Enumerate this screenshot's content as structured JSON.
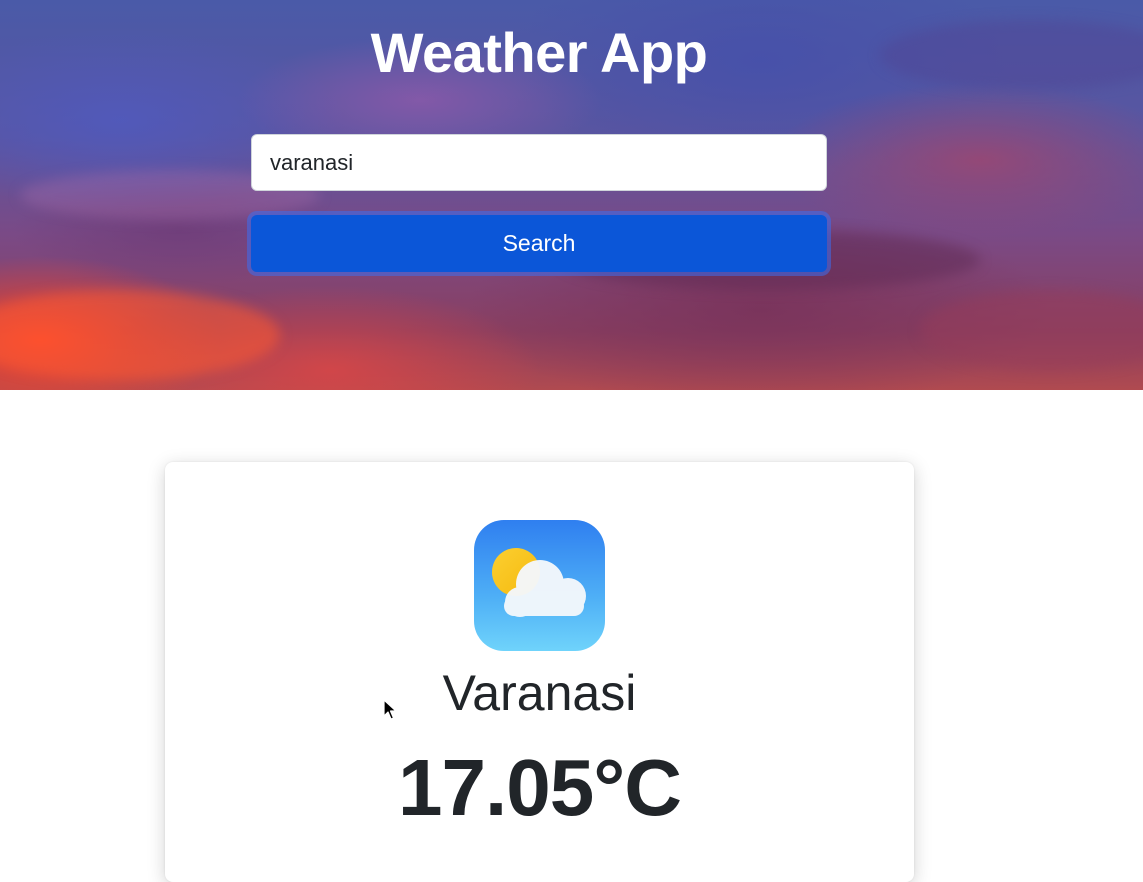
{
  "header": {
    "title": "Weather App"
  },
  "search": {
    "value": "varanasi",
    "button_label": "Search"
  },
  "weather": {
    "icon": "partly-cloudy-icon",
    "city": "Varanasi",
    "temperature": "17.05°C"
  },
  "colors": {
    "accent": "#0b56d8",
    "text": "#212529",
    "card_background": "#ffffff"
  }
}
